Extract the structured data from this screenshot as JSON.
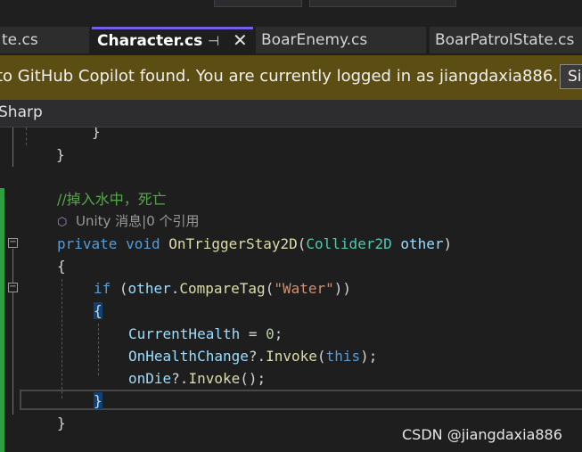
{
  "tabs": [
    {
      "label": "te.cs"
    },
    {
      "label": "Character.cs",
      "active": true
    },
    {
      "label": "BoarEnemy.cs"
    },
    {
      "label": "BoarPatrolState.cs"
    }
  ],
  "infobar": {
    "message": "to GitHub Copilot found. You are currently logged in as jiangdaxia886.",
    "button_label": "Si"
  },
  "navbar": {
    "project": "Sharp"
  },
  "code": {
    "l1_brace": "}",
    "l2_brace": "}",
    "comment": "//掉入水中，死亡",
    "lens": "Unity 消息|0 个引用",
    "sig_private": "private",
    "sig_void": "void",
    "sig_name": "OnTriggerStay2D",
    "sig_open": "(",
    "sig_type": "Collider2D",
    "sig_param": "other",
    "sig_close": ")",
    "open_brace": "{",
    "if_kw": "if",
    "if_open": "(",
    "if_var": "other",
    "if_dot": ".",
    "if_method": "CompareTag",
    "if_paren": "(",
    "if_str": "\"Water\"",
    "if_close": "))",
    "inner_open": "{",
    "stmt1_var": "CurrentHealth",
    "stmt1_eq": " = ",
    "stmt1_num": "0",
    "stmt1_end": ";",
    "stmt2_var": "OnHealthChange",
    "stmt2_op": "?.",
    "stmt2_method": "Invoke",
    "stmt2_open": "(",
    "stmt2_this": "this",
    "stmt2_end": ");",
    "stmt3_var": "onDie",
    "stmt3_op": "?.",
    "stmt3_method": "Invoke",
    "stmt3_end": "();",
    "inner_close": "}",
    "method_close": "}"
  },
  "watermark": "CSDN @jiangdaxia886",
  "colors": {
    "keyword": "#569cd6",
    "method": "#dcdcaa",
    "type": "#4ec9b0",
    "variable": "#9cdcfe",
    "string": "#ce9178",
    "comment": "#57a64a",
    "active_tab_accent": "#7160e8",
    "infobar_bg": "#5c4d13"
  },
  "icons": {
    "pin": "pin-icon",
    "close": "close-icon",
    "unity": "unity-cube-icon"
  }
}
